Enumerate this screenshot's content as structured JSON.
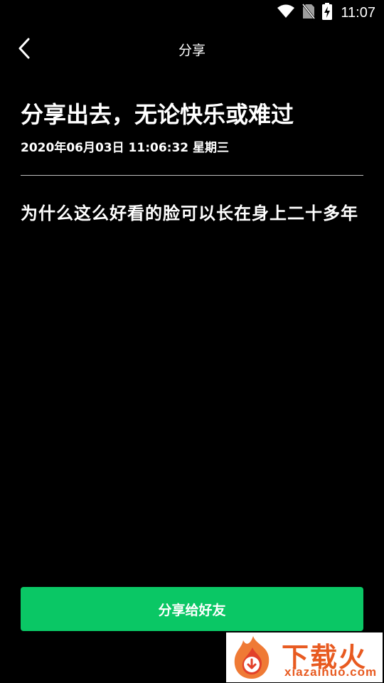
{
  "status_bar": {
    "time": "11:07",
    "icons": [
      "wifi-icon",
      "no-sim-icon",
      "battery-charging-icon"
    ]
  },
  "app_bar": {
    "back_icon": "chevron-left-icon",
    "title": "分享"
  },
  "content": {
    "headline": "分享出去，无论快乐或难过",
    "timestamp": "2020年06月03日 11:06:32 星期三",
    "body": "为什么这么好看的脸可以长在身上二十多年"
  },
  "share_button": {
    "label": "分享给好友"
  },
  "watermark": {
    "text": "下载火",
    "domain": "xiazaihuo.com"
  },
  "colors": {
    "background": "#000000",
    "accent": "#0ac765",
    "watermark": "#e85a20"
  }
}
